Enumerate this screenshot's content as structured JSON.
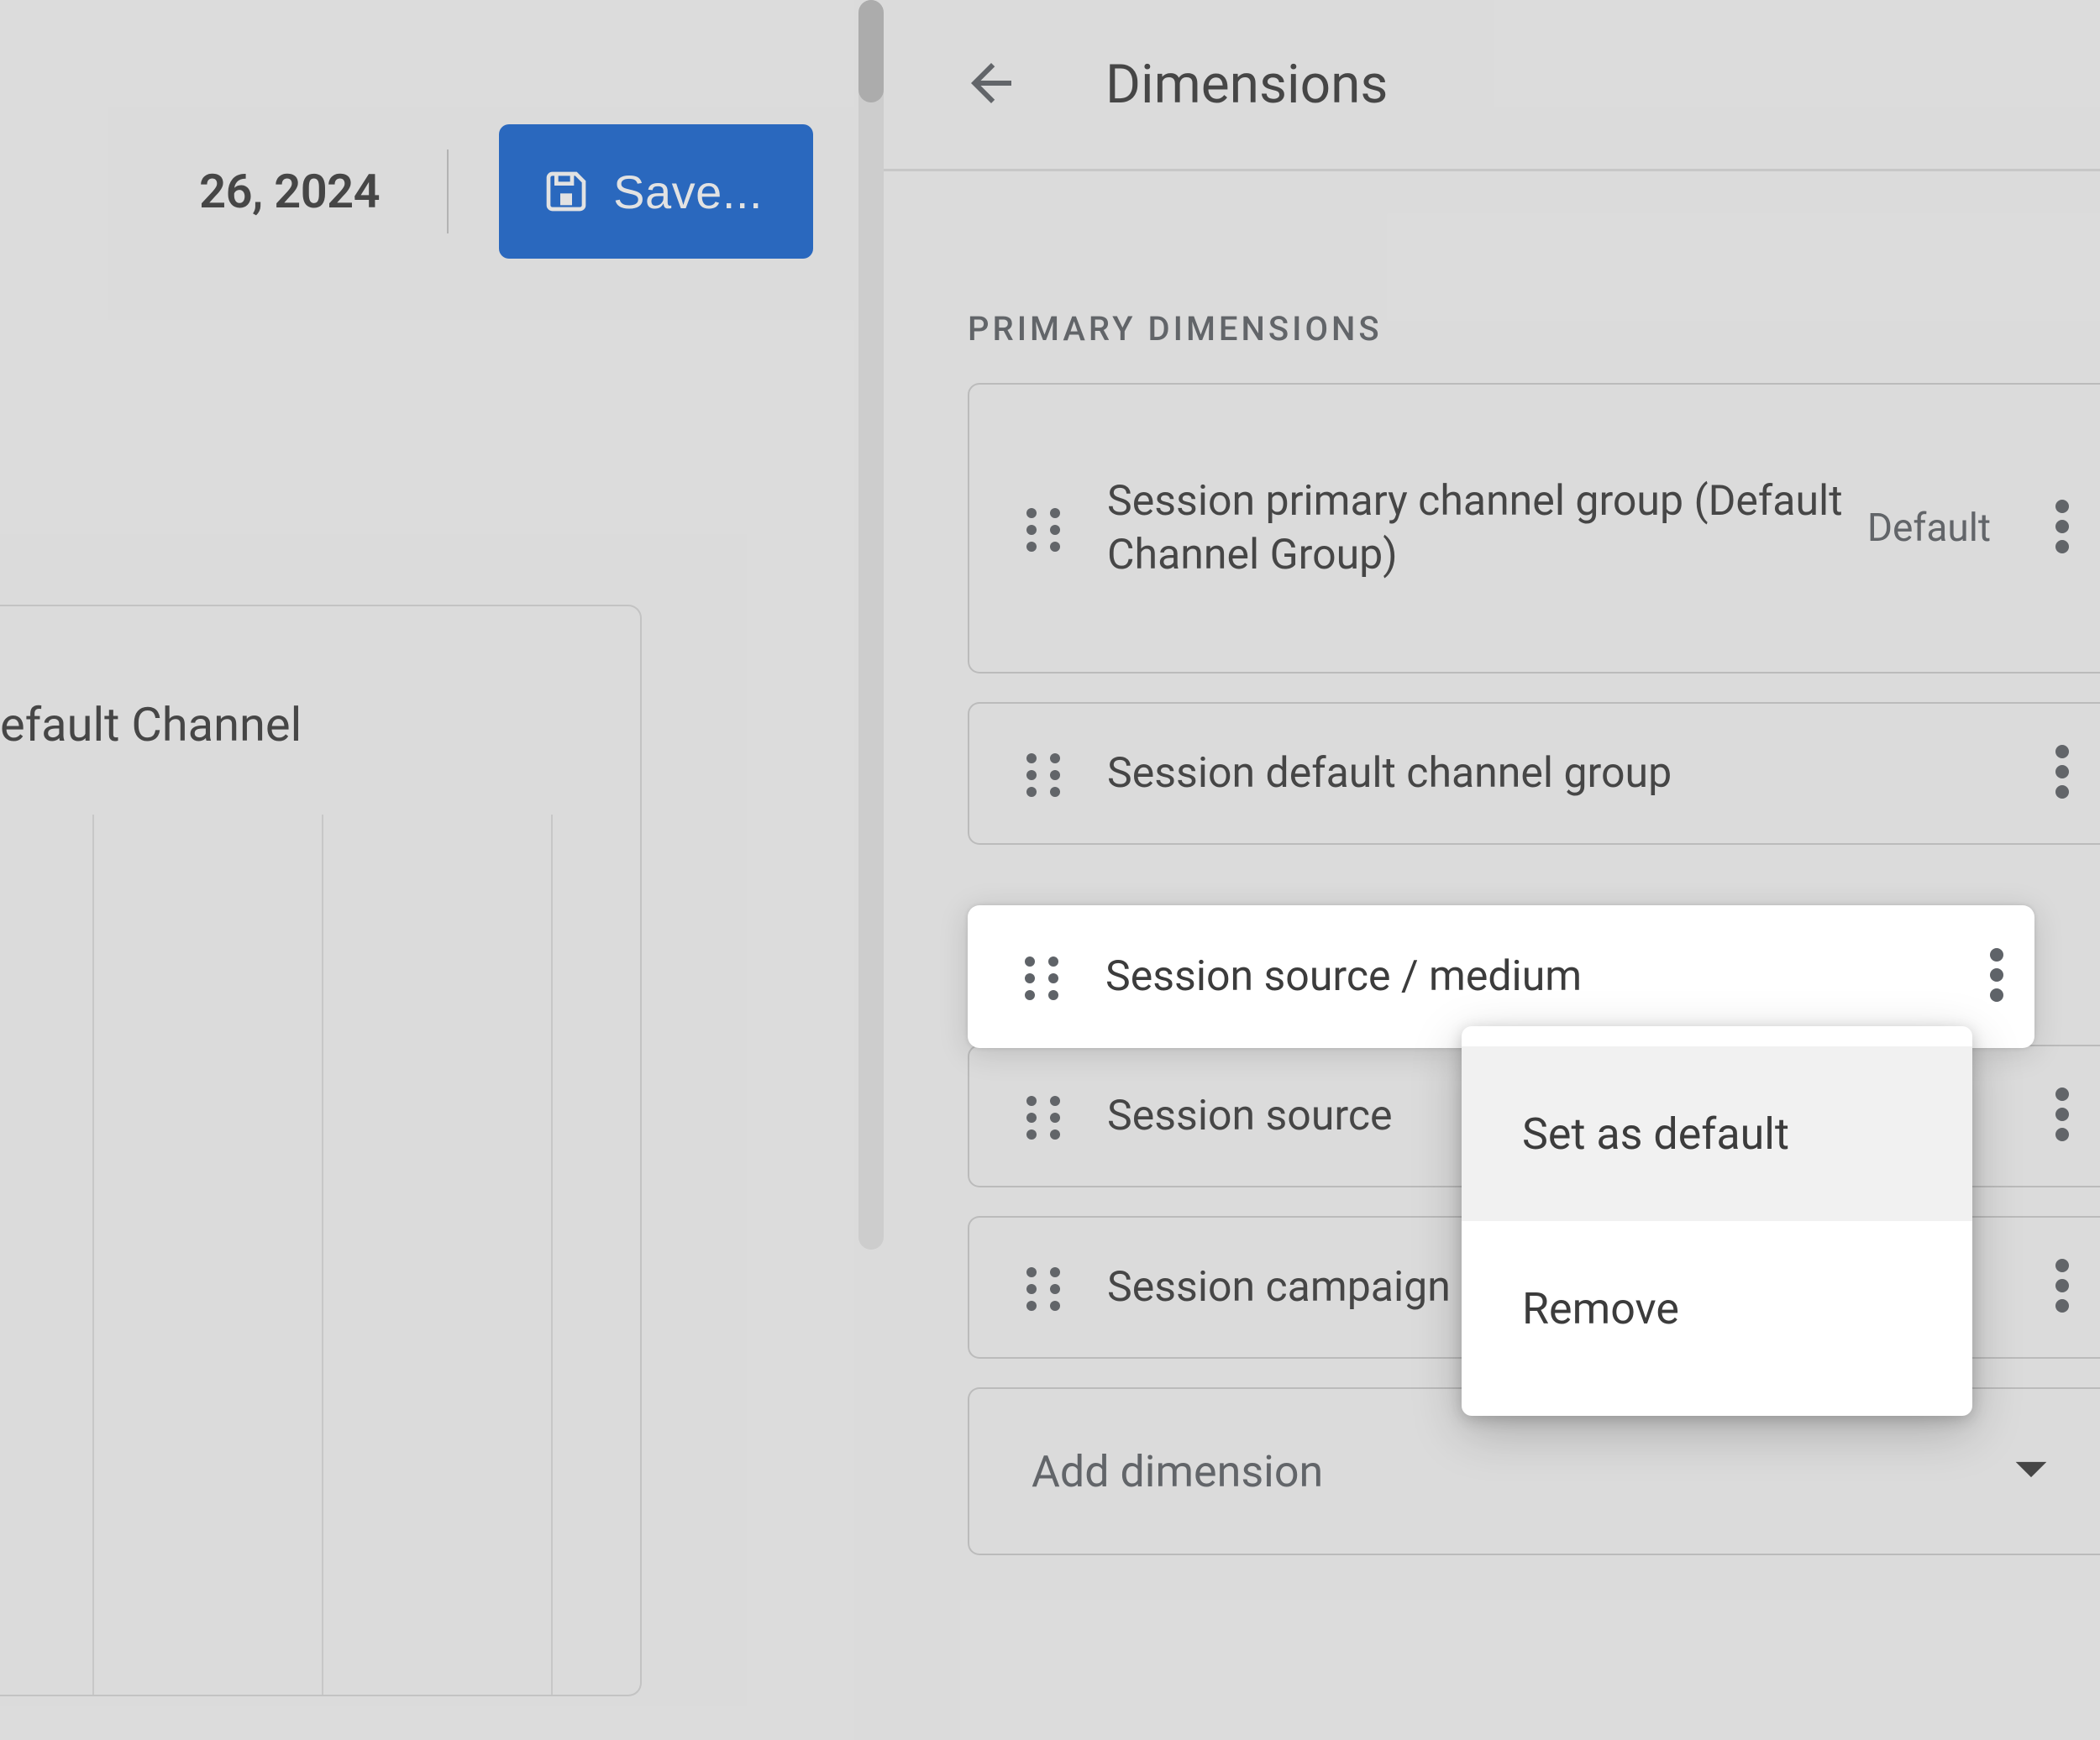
{
  "topbar": {
    "date_fragment": "26, 2024",
    "save_label": "Save..."
  },
  "left_card": {
    "title_fragment": "efault Channel"
  },
  "panel": {
    "title": "Dimensions",
    "section_label": "PRIMARY DIMENSIONS",
    "default_tag": "Default",
    "add_label": "Add dimension",
    "items": [
      {
        "label": "Session primary channel group (Default Channel Group)",
        "is_default": true
      },
      {
        "label": "Session default channel group",
        "is_default": false
      },
      {
        "label": "Session source / medium",
        "is_default": false
      },
      {
        "label": "Session source",
        "is_default": false
      },
      {
        "label": "Session campaign",
        "is_default": false
      }
    ]
  },
  "menu": {
    "items": [
      "Set as default",
      "Remove"
    ]
  }
}
